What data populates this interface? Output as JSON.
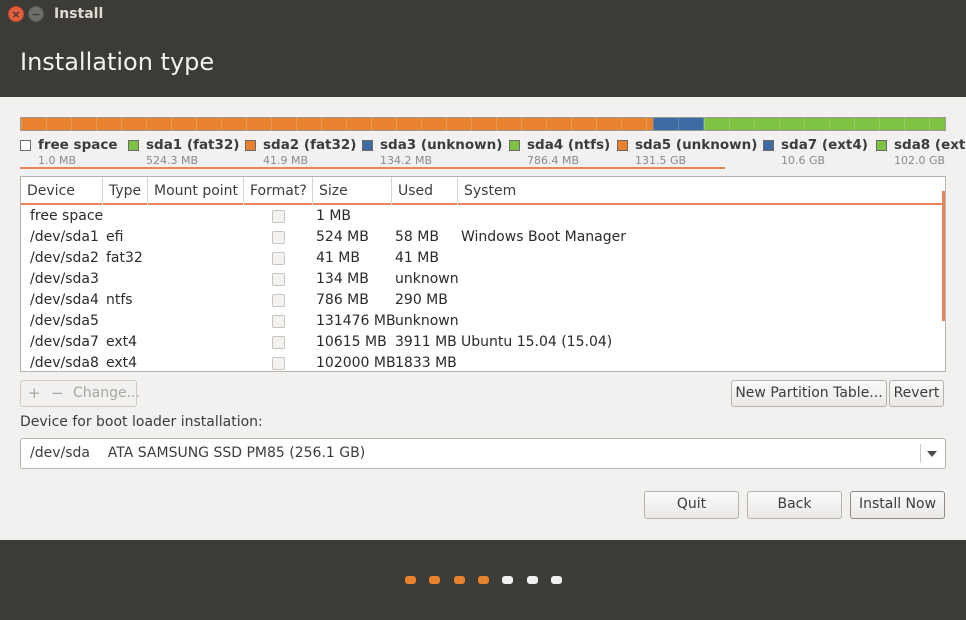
{
  "window": {
    "title": "Install",
    "close_glyph": "×",
    "minimize_glyph": "−"
  },
  "header": {
    "title": "Installation type"
  },
  "disk_bar": {
    "segments": [
      {
        "color": "#e95c1b",
        "fraction": 0.0
      },
      {
        "color": "#e9822e",
        "fraction": 0.684
      },
      {
        "color": "#3f6ba3",
        "fraction": 0.055
      },
      {
        "color": "#7dc242",
        "fraction": 0.261
      }
    ]
  },
  "legend": [
    {
      "name": "free space",
      "size": "1.0 MB",
      "color": "#ffffff"
    },
    {
      "name": "sda1 (fat32)",
      "size": "524.3 MB",
      "color": "#7dc242"
    },
    {
      "name": "sda2 (fat32)",
      "size": "41.9 MB",
      "color": "#e9822e"
    },
    {
      "name": "sda3 (unknown)",
      "size": "134.2 MB",
      "color": "#3f6ba3"
    },
    {
      "name": "sda4 (ntfs)",
      "size": "786.4 MB",
      "color": "#7dc242"
    },
    {
      "name": "sda5 (unknown)",
      "size": "131.5 GB",
      "color": "#e9822e"
    },
    {
      "name": "sda7 (ext4)",
      "size": "10.6 GB",
      "color": "#3f6ba3"
    },
    {
      "name": "sda8 (ext4)",
      "size": "102.0 GB",
      "color": "#7dc242"
    }
  ],
  "table": {
    "columns": [
      "Device",
      "Type",
      "Mount point",
      "Format?",
      "Size",
      "Used",
      "System"
    ],
    "rows": [
      {
        "device": "free space",
        "type": "",
        "mount": "",
        "size": "1 MB",
        "used": "",
        "system": ""
      },
      {
        "device": "/dev/sda1",
        "type": "efi",
        "mount": "",
        "size": "524 MB",
        "used": "58 MB",
        "system": "Windows Boot Manager"
      },
      {
        "device": "/dev/sda2",
        "type": "fat32",
        "mount": "",
        "size": "41 MB",
        "used": "41 MB",
        "system": ""
      },
      {
        "device": "/dev/sda3",
        "type": "",
        "mount": "",
        "size": "134 MB",
        "used": "unknown",
        "system": ""
      },
      {
        "device": "/dev/sda4",
        "type": "ntfs",
        "mount": "",
        "size": "786 MB",
        "used": "290 MB",
        "system": ""
      },
      {
        "device": "/dev/sda5",
        "type": "",
        "mount": "",
        "size": "131476 MB",
        "used": "unknown",
        "system": ""
      },
      {
        "device": "/dev/sda7",
        "type": "ext4",
        "mount": "",
        "size": "10615 MB",
        "used": "3911 MB",
        "system": "Ubuntu 15.04 (15.04)"
      },
      {
        "device": "/dev/sda8",
        "type": "ext4",
        "mount": "",
        "size": "102000 MB",
        "used": "1833 MB",
        "system": ""
      }
    ]
  },
  "actions": {
    "add": "+",
    "remove": "−",
    "change": "Change...",
    "new_table": "New Partition Table...",
    "revert": "Revert"
  },
  "bootloader": {
    "label": "Device for boot loader installation:",
    "value": "/dev/sda    ATA SAMSUNG SSD PM85 (256.1 GB)"
  },
  "buttons": {
    "quit": "Quit",
    "back": "Back",
    "install": "Install Now"
  },
  "progress": {
    "total_steps": 7,
    "completed_steps": 4,
    "done_color": "#e9822e",
    "todo_color": "#f2f1f0"
  }
}
